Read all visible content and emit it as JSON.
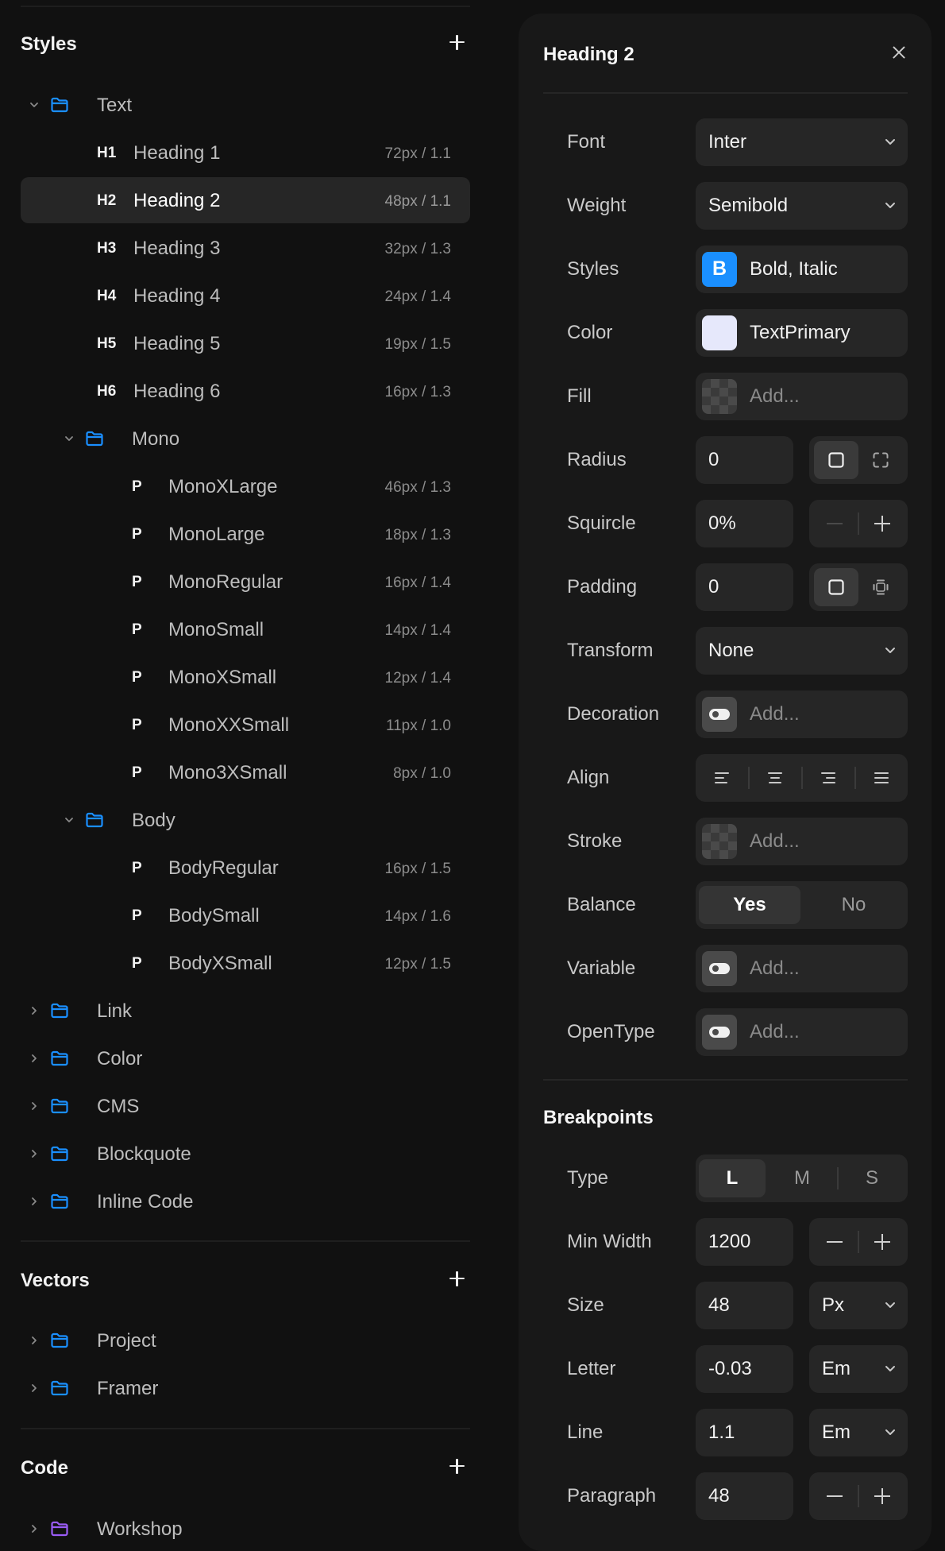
{
  "left": {
    "styles_title": "Styles",
    "vectors_title": "Vectors",
    "code_title": "Code",
    "text_folder": "Text",
    "headings": [
      {
        "tag": "H1",
        "name": "Heading 1",
        "meta": "72px / 1.1"
      },
      {
        "tag": "H2",
        "name": "Heading 2",
        "meta": "48px / 1.1"
      },
      {
        "tag": "H3",
        "name": "Heading 3",
        "meta": "32px / 1.3"
      },
      {
        "tag": "H4",
        "name": "Heading 4",
        "meta": "24px / 1.4"
      },
      {
        "tag": "H5",
        "name": "Heading 5",
        "meta": "19px / 1.5"
      },
      {
        "tag": "H6",
        "name": "Heading 6",
        "meta": "16px / 1.3"
      }
    ],
    "mono_folder": "Mono",
    "mono": [
      {
        "tag": "P",
        "name": "MonoXLarge",
        "meta": "46px / 1.3"
      },
      {
        "tag": "P",
        "name": "MonoLarge",
        "meta": "18px / 1.3"
      },
      {
        "tag": "P",
        "name": "MonoRegular",
        "meta": "16px / 1.4"
      },
      {
        "tag": "P",
        "name": "MonoSmall",
        "meta": "14px / 1.4"
      },
      {
        "tag": "P",
        "name": "MonoXSmall",
        "meta": "12px / 1.4"
      },
      {
        "tag": "P",
        "name": "MonoXXSmall",
        "meta": "11px / 1.0"
      },
      {
        "tag": "P",
        "name": "Mono3XSmall",
        "meta": "8px / 1.0"
      }
    ],
    "body_folder": "Body",
    "body": [
      {
        "tag": "P",
        "name": "BodyRegular",
        "meta": "16px / 1.5"
      },
      {
        "tag": "P",
        "name": "BodySmall",
        "meta": "14px / 1.6"
      },
      {
        "tag": "P",
        "name": "BodyXSmall",
        "meta": "12px / 1.5"
      }
    ],
    "collapsed_folders": [
      "Link",
      "Color",
      "CMS",
      "Blockquote",
      "Inline Code"
    ],
    "vector_folders": [
      "Project",
      "Framer"
    ],
    "code_folders": [
      "Workshop"
    ]
  },
  "right": {
    "title": "Heading 2",
    "props": {
      "font": {
        "label": "Font",
        "value": "Inter"
      },
      "weight": {
        "label": "Weight",
        "value": "Semibold"
      },
      "styles": {
        "label": "Styles",
        "value": "Bold, Italic",
        "icon_letter": "B"
      },
      "color": {
        "label": "Color",
        "value": "TextPrimary"
      },
      "fill": {
        "label": "Fill",
        "placeholder": "Add..."
      },
      "radius": {
        "label": "Radius",
        "value": "0"
      },
      "squircle": {
        "label": "Squircle",
        "value": "0%"
      },
      "padding": {
        "label": "Padding",
        "value": "0"
      },
      "transform": {
        "label": "Transform",
        "value": "None"
      },
      "decoration": {
        "label": "Decoration",
        "placeholder": "Add..."
      },
      "align": {
        "label": "Align"
      },
      "stroke": {
        "label": "Stroke",
        "placeholder": "Add..."
      },
      "balance": {
        "label": "Balance",
        "yes": "Yes",
        "no": "No"
      },
      "variable": {
        "label": "Variable",
        "placeholder": "Add..."
      },
      "opentype": {
        "label": "OpenType",
        "placeholder": "Add..."
      }
    },
    "breakpoints": {
      "title": "Breakpoints",
      "type": {
        "label": "Type",
        "options": [
          "L",
          "M",
          "S"
        ],
        "selected": "L"
      },
      "min_width": {
        "label": "Min Width",
        "value": "1200"
      },
      "size": {
        "label": "Size",
        "value": "48",
        "unit": "Px"
      },
      "letter": {
        "label": "Letter",
        "value": "-0.03",
        "unit": "Em"
      },
      "line": {
        "label": "Line",
        "value": "1.1",
        "unit": "Em"
      },
      "paragraph": {
        "label": "Paragraph",
        "value": "48"
      }
    }
  },
  "colors": {
    "accent": "#1a8fff",
    "code_folder": "#9b5cf6",
    "swatch_text_primary": "#e6e8fb"
  }
}
